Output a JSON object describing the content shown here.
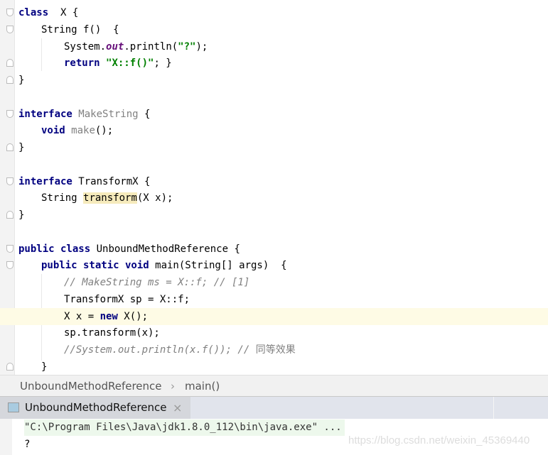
{
  "editor": {
    "lines": [
      {
        "tokens": [
          [
            "kw",
            "class"
          ],
          [
            "",
            "  X {"
          ]
        ],
        "indent": 0,
        "fold": "open"
      },
      {
        "tokens": [
          [
            "",
            "String f()  {"
          ]
        ],
        "indent": 1,
        "fold": "open"
      },
      {
        "tokens": [
          [
            "",
            "System."
          ],
          [
            "fld",
            "out"
          ],
          [
            "",
            ".println("
          ],
          [
            "str",
            "\"?\""
          ],
          [
            "",
            ");"
          ]
        ],
        "indent": 2
      },
      {
        "tokens": [
          [
            "kw",
            "return"
          ],
          [
            "",
            " "
          ],
          [
            "str",
            "\"X::f()\""
          ],
          [
            "",
            "; }"
          ]
        ],
        "indent": 2,
        "fold": "close"
      },
      {
        "tokens": [
          [
            "",
            "}"
          ]
        ],
        "indent": 0,
        "fold": "close"
      },
      {
        "tokens": [],
        "indent": 0
      },
      {
        "tokens": [
          [
            "kw",
            "interface"
          ],
          [
            "",
            " "
          ],
          [
            "gray",
            "MakeString"
          ],
          [
            "",
            " {"
          ]
        ],
        "indent": 0,
        "fold": "open"
      },
      {
        "tokens": [
          [
            "kw",
            "void"
          ],
          [
            "",
            " "
          ],
          [
            "gray",
            "make"
          ],
          [
            "",
            "();"
          ]
        ],
        "indent": 1
      },
      {
        "tokens": [
          [
            "",
            "}"
          ]
        ],
        "indent": 0,
        "fold": "close"
      },
      {
        "tokens": [],
        "indent": 0
      },
      {
        "tokens": [
          [
            "kw",
            "interface"
          ],
          [
            "",
            " TransformX {"
          ]
        ],
        "indent": 0,
        "fold": "open"
      },
      {
        "tokens": [
          [
            "",
            "String "
          ],
          [
            "hl",
            "transform"
          ],
          [
            "",
            "(X x);"
          ]
        ],
        "indent": 1
      },
      {
        "tokens": [
          [
            "",
            "}"
          ]
        ],
        "indent": 0,
        "fold": "close"
      },
      {
        "tokens": [],
        "indent": 0
      },
      {
        "tokens": [
          [
            "kw",
            "public class"
          ],
          [
            "",
            " UnboundMethodReference {"
          ]
        ],
        "indent": 0,
        "fold": "open"
      },
      {
        "tokens": [
          [
            "kw",
            "public static void"
          ],
          [
            "",
            " main(String[] args)  {"
          ]
        ],
        "indent": 1,
        "fold": "open"
      },
      {
        "tokens": [
          [
            "cm",
            "// MakeString ms = X::f; // [1]"
          ]
        ],
        "indent": 2
      },
      {
        "tokens": [
          [
            "",
            "TransformX sp = X::f;"
          ]
        ],
        "indent": 2
      },
      {
        "tokens": [
          [
            "",
            "X x = "
          ],
          [
            "kw",
            "new"
          ],
          [
            "",
            " X();"
          ]
        ],
        "indent": 2,
        "current": true
      },
      {
        "tokens": [
          [
            "",
            "sp.transform(x);"
          ]
        ],
        "indent": 2
      },
      {
        "tokens": [
          [
            "cm",
            "//System.out.println(x.f()); // "
          ],
          [
            "gray",
            "同等效果"
          ]
        ],
        "indent": 2
      },
      {
        "tokens": [
          [
            "",
            "}"
          ]
        ],
        "indent": 1,
        "fold": "close"
      }
    ]
  },
  "breadcrumb": {
    "items": [
      "UnboundMethodReference",
      "main()"
    ],
    "separator": "›"
  },
  "run_tab": {
    "label": "UnboundMethodReference",
    "close": "×"
  },
  "console": {
    "lines": [
      "\"C:\\Program Files\\Java\\jdk1.8.0_112\\bin\\java.exe\" ...",
      "?"
    ]
  },
  "watermark": "https://blog.csdn.net/weixin_45369440"
}
